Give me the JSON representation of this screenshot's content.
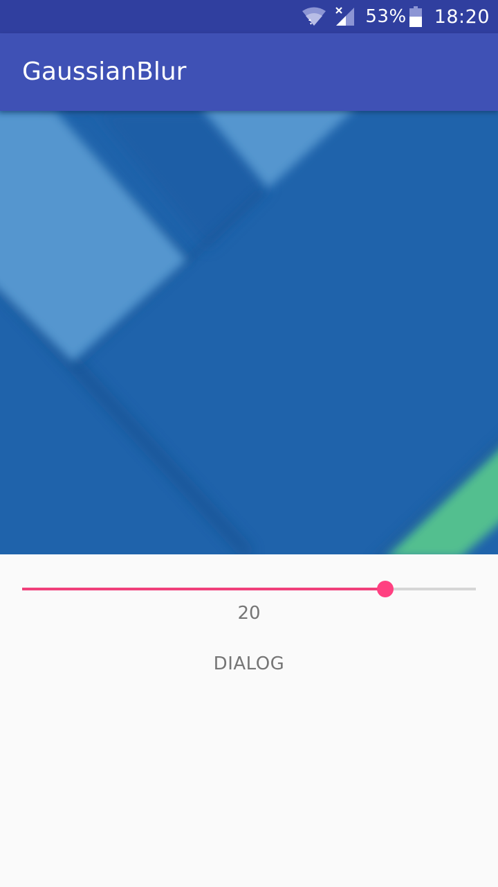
{
  "status_bar": {
    "battery_percent": "53%",
    "time": "18:20",
    "icons": [
      "wifi-icon",
      "signal-icon",
      "battery-icon"
    ]
  },
  "app_bar": {
    "title": "GaussianBlur"
  },
  "image": {
    "icon": "blurred-material-background-image"
  },
  "slider": {
    "value": 20,
    "fraction": 0.8
  },
  "controls": {
    "value_label": "20",
    "dialog_button": "DIALOG"
  },
  "colors": {
    "status_bar": "#303f9f",
    "app_bar": "#3f51b5",
    "accent": "#ff4081",
    "image_base": "#1f63ab",
    "image_light": "#5596cf",
    "image_green": "#52bf8f",
    "text_gray": "#757575"
  }
}
